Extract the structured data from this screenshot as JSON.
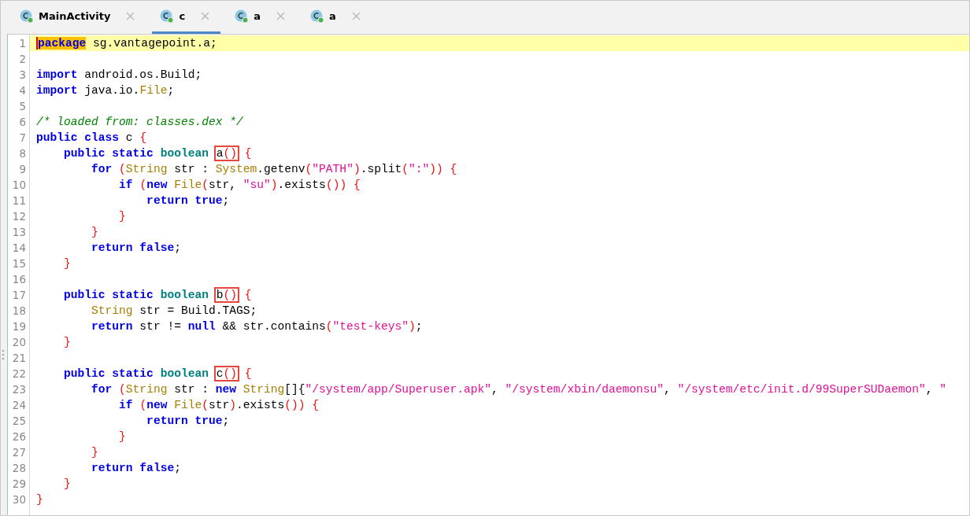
{
  "tabs": [
    {
      "label": "MainActivity",
      "selected": false
    },
    {
      "label": "c",
      "selected": true
    },
    {
      "label": "a",
      "selected": false
    },
    {
      "label": "a",
      "selected": false
    }
  ],
  "code": {
    "lines": [
      {
        "number": "1",
        "current": true,
        "tokens": [
          {
            "kind": "keyword_selected",
            "text": "package"
          },
          {
            "kind": "text",
            "text": " sg.vantagepoint.a;"
          }
        ]
      },
      {
        "number": "2",
        "current": false
      },
      {
        "number": "3",
        "current": false,
        "tokens": [
          {
            "kind": "keyword",
            "text": "import"
          },
          {
            "kind": "text",
            "text": " android.os.Build;"
          }
        ]
      },
      {
        "number": "4",
        "current": false,
        "tokens": [
          {
            "kind": "keyword",
            "text": "import"
          },
          {
            "kind": "text",
            "text": " java.io."
          },
          {
            "kind": "type",
            "text": "File"
          },
          {
            "kind": "text",
            "text": ";"
          }
        ]
      },
      {
        "number": "5",
        "current": false
      },
      {
        "number": "6",
        "current": false,
        "tokens": [
          {
            "kind": "comment",
            "text": "/* loaded from: classes.dex */"
          }
        ]
      },
      {
        "number": "7",
        "current": false,
        "tokens": [
          {
            "kind": "keyword",
            "text": "public class"
          },
          {
            "kind": "text",
            "text": " c "
          },
          {
            "kind": "punct",
            "text": "{"
          }
        ]
      },
      {
        "number": "8",
        "current": false,
        "tokens": [
          {
            "kind": "keyword",
            "text": "    public static "
          },
          {
            "kind": "primitive",
            "text": "boolean "
          },
          {
            "kind": "box",
            "tokens": [
              {
                "kind": "text",
                "text": "a"
              },
              {
                "kind": "punct",
                "text": "()"
              }
            ]
          },
          {
            "kind": "punct",
            "text": " {"
          }
        ]
      },
      {
        "number": "9",
        "current": false,
        "tokens": [
          {
            "kind": "keyword",
            "text": "        for "
          },
          {
            "kind": "punct",
            "text": "("
          },
          {
            "kind": "type",
            "text": "String"
          },
          {
            "kind": "text",
            "text": " str : "
          },
          {
            "kind": "type",
            "text": "System"
          },
          {
            "kind": "text",
            "text": ".getenv"
          },
          {
            "kind": "punct",
            "text": "("
          },
          {
            "kind": "string",
            "text": "\"PATH\""
          },
          {
            "kind": "punct",
            "text": ")"
          },
          {
            "kind": "text",
            "text": ".split"
          },
          {
            "kind": "punct",
            "text": "("
          },
          {
            "kind": "string",
            "text": "\":\""
          },
          {
            "kind": "punct",
            "text": ")) {"
          }
        ]
      },
      {
        "number": "10",
        "current": false,
        "tokens": [
          {
            "kind": "keyword",
            "text": "            if "
          },
          {
            "kind": "punct",
            "text": "("
          },
          {
            "kind": "keyword",
            "text": "new "
          },
          {
            "kind": "type",
            "text": "File"
          },
          {
            "kind": "punct",
            "text": "("
          },
          {
            "kind": "text",
            "text": "str, "
          },
          {
            "kind": "string",
            "text": "\"su\""
          },
          {
            "kind": "punct",
            "text": ")"
          },
          {
            "kind": "text",
            "text": ".exists"
          },
          {
            "kind": "punct",
            "text": "()) {"
          }
        ]
      },
      {
        "number": "11",
        "current": false,
        "tokens": [
          {
            "kind": "keyword",
            "text": "                return true"
          },
          {
            "kind": "text",
            "text": ";"
          }
        ]
      },
      {
        "number": "12",
        "current": false,
        "tokens": [
          {
            "kind": "punct",
            "text": "            }"
          }
        ]
      },
      {
        "number": "13",
        "current": false,
        "tokens": [
          {
            "kind": "punct",
            "text": "        }"
          }
        ]
      },
      {
        "number": "14",
        "current": false,
        "tokens": [
          {
            "kind": "keyword",
            "text": "        return false"
          },
          {
            "kind": "text",
            "text": ";"
          }
        ]
      },
      {
        "number": "15",
        "current": false,
        "tokens": [
          {
            "kind": "punct",
            "text": "    }"
          }
        ]
      },
      {
        "number": "16",
        "current": false
      },
      {
        "number": "17",
        "current": false,
        "tokens": [
          {
            "kind": "keyword",
            "text": "    public static "
          },
          {
            "kind": "primitive",
            "text": "boolean "
          },
          {
            "kind": "box",
            "tokens": [
              {
                "kind": "text",
                "text": "b"
              },
              {
                "kind": "punct",
                "text": "()"
              }
            ]
          },
          {
            "kind": "punct",
            "text": " {"
          }
        ]
      },
      {
        "number": "18",
        "current": false,
        "tokens": [
          {
            "kind": "type",
            "text": "        String"
          },
          {
            "kind": "text",
            "text": " str = Build.TAGS;"
          }
        ]
      },
      {
        "number": "19",
        "current": false,
        "tokens": [
          {
            "kind": "keyword",
            "text": "        return"
          },
          {
            "kind": "text",
            "text": " str != "
          },
          {
            "kind": "keyword",
            "text": "null"
          },
          {
            "kind": "text",
            "text": " && str.contains"
          },
          {
            "kind": "punct",
            "text": "("
          },
          {
            "kind": "string",
            "text": "\"test-keys\""
          },
          {
            "kind": "punct",
            "text": ")"
          },
          {
            "kind": "text",
            "text": ";"
          }
        ]
      },
      {
        "number": "20",
        "current": false,
        "tokens": [
          {
            "kind": "punct",
            "text": "    }"
          }
        ]
      },
      {
        "number": "21",
        "current": false
      },
      {
        "number": "22",
        "current": false,
        "tokens": [
          {
            "kind": "keyword",
            "text": "    public static "
          },
          {
            "kind": "primitive",
            "text": "boolean "
          },
          {
            "kind": "box",
            "tokens": [
              {
                "kind": "text",
                "text": "c"
              },
              {
                "kind": "punct",
                "text": "()"
              }
            ]
          },
          {
            "kind": "punct",
            "text": " {"
          }
        ]
      },
      {
        "number": "23",
        "current": false,
        "tokens": [
          {
            "kind": "keyword",
            "text": "        for "
          },
          {
            "kind": "punct",
            "text": "("
          },
          {
            "kind": "type",
            "text": "String"
          },
          {
            "kind": "text",
            "text": " str : "
          },
          {
            "kind": "keyword",
            "text": "new "
          },
          {
            "kind": "type",
            "text": "String"
          },
          {
            "kind": "text",
            "text": "[]{"
          },
          {
            "kind": "string",
            "text": "\"/system/app/Superuser.apk\""
          },
          {
            "kind": "text",
            "text": ", "
          },
          {
            "kind": "string",
            "text": "\"/system/xbin/daemonsu\""
          },
          {
            "kind": "text",
            "text": ", "
          },
          {
            "kind": "string",
            "text": "\"/system/etc/init.d/99SuperSUDaemon\""
          },
          {
            "kind": "text",
            "text": ", "
          },
          {
            "kind": "string",
            "text": "\""
          }
        ]
      },
      {
        "number": "24",
        "current": false,
        "tokens": [
          {
            "kind": "keyword",
            "text": "            if "
          },
          {
            "kind": "punct",
            "text": "("
          },
          {
            "kind": "keyword",
            "text": "new "
          },
          {
            "kind": "type",
            "text": "File"
          },
          {
            "kind": "punct",
            "text": "("
          },
          {
            "kind": "text",
            "text": "str"
          },
          {
            "kind": "punct",
            "text": ")"
          },
          {
            "kind": "text",
            "text": ".exists"
          },
          {
            "kind": "punct",
            "text": "()) {"
          }
        ]
      },
      {
        "number": "25",
        "current": false,
        "tokens": [
          {
            "kind": "keyword",
            "text": "                return true"
          },
          {
            "kind": "text",
            "text": ";"
          }
        ]
      },
      {
        "number": "26",
        "current": false,
        "tokens": [
          {
            "kind": "punct",
            "text": "            }"
          }
        ]
      },
      {
        "number": "27",
        "current": false,
        "tokens": [
          {
            "kind": "punct",
            "text": "        }"
          }
        ]
      },
      {
        "number": "28",
        "current": false,
        "tokens": [
          {
            "kind": "keyword",
            "text": "        return false"
          },
          {
            "kind": "text",
            "text": ";"
          }
        ]
      },
      {
        "number": "29",
        "current": false,
        "tokens": [
          {
            "kind": "punct",
            "text": "    }"
          }
        ]
      },
      {
        "number": "30",
        "current": false,
        "tokens": [
          {
            "kind": "punct",
            "text": "}"
          }
        ]
      }
    ]
  }
}
